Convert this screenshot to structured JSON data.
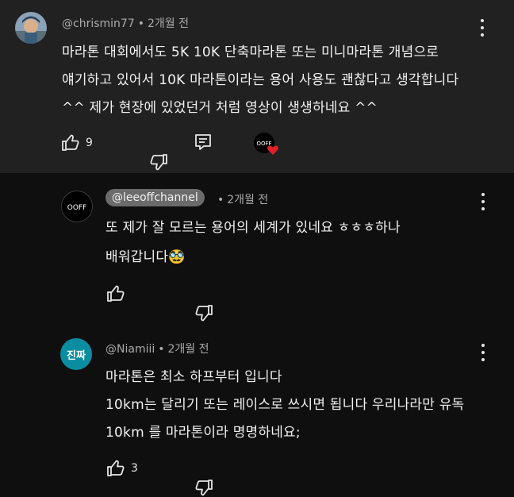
{
  "comment": {
    "handle": "@chrismin77",
    "time": "2개월 전",
    "lines": [
      "마라톤 대회에서도 5K 10K 단축마라톤 또는 미니마라톤 개념으로",
      "얘기하고 있어서 10K 마라톤이라는 용어 사용도 괜찮다고 생각합니다",
      "^^ 제가 현장에 있었던거 처럼 영상이 생생하네요 ^^"
    ],
    "like_count": "9",
    "creator_badge_text": "OOFF"
  },
  "replies": [
    {
      "handle": "@leeoffchannel",
      "time": "2개월 전",
      "avatar_text": "OOFF",
      "lines": [
        "또 제가 잘 모르는 용어의 세계가 있네요 ㅎㅎㅎ하나",
        "배워갑니다🥸"
      ],
      "like_count": ""
    },
    {
      "handle": "@Niamiii",
      "time": "2개월 전",
      "avatar_text": "진짜",
      "lines": [
        "마라톤은 최소 하프부터 입니다",
        "10km는 달리기 또는 레이스로 쓰시면 됩니다 우리나라만 유독",
        "10km 를 마라톤이라 명명하네요;"
      ],
      "like_count": "3"
    }
  ],
  "meta": {
    "separator": "•",
    "accent": "#0a8da0",
    "heart_color": "#e0202a",
    "pill_bg": "#6b6b6b"
  }
}
